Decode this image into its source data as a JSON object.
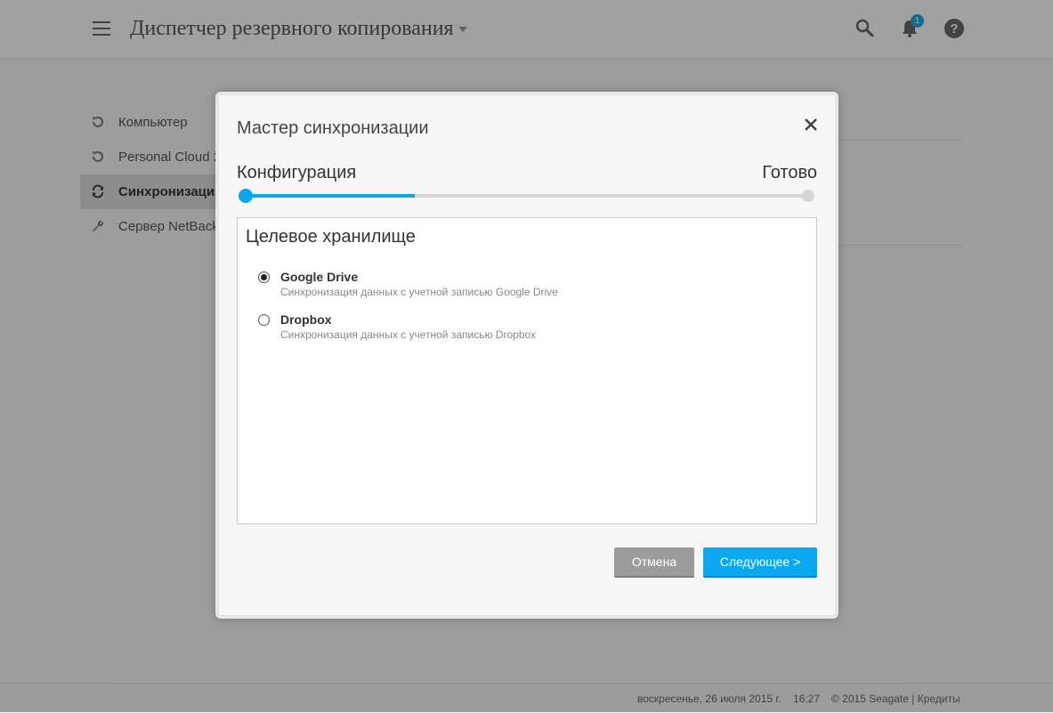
{
  "header": {
    "title": "Диспетчер резервного копирования",
    "notification_count": "1",
    "icons": [
      "menu-icon",
      "search-icon",
      "bell-icon",
      "help-icon"
    ]
  },
  "sidebar": {
    "items": [
      {
        "label": "Компьютер",
        "icon": "backup-icon"
      },
      {
        "label": "Personal Cloud 2",
        "icon": "backup-icon"
      },
      {
        "label": "Синхронизация",
        "icon": "sync-icon",
        "active": true
      },
      {
        "label": "Сервер NetBackup",
        "icon": "wrench-icon"
      }
    ]
  },
  "footer": {
    "date": "воскресенье, 26 июля 2015 г.",
    "time": "16:27",
    "copyright": "© 2015 Seagate | Кредиты"
  },
  "modal": {
    "title": "Мастер синхронизации",
    "step_current": "Конфигурация",
    "step_final": "Готово",
    "progress": 0.3,
    "panel_title": "Целевое хранилище",
    "options": [
      {
        "name": "Google Drive",
        "description": "Синхронизация данных с учетной записью Google Drive",
        "selected": true
      },
      {
        "name": "Dropbox",
        "description": "Синхронизация данных с учетной записью Dropbox",
        "selected": false
      }
    ],
    "cancel_label": "Отмена",
    "next_label": "Следующее >"
  },
  "colors": {
    "accent": "#0aa8f0",
    "cancel": "#9c9c9c"
  }
}
